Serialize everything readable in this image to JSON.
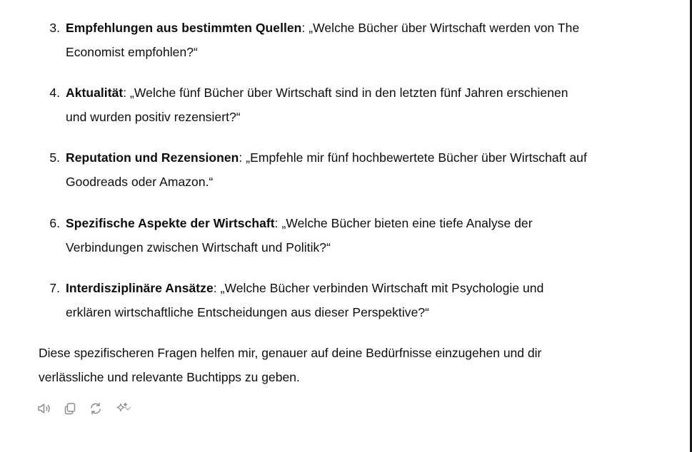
{
  "items": [
    {
      "number": "3.",
      "title": "Empfehlungen aus bestimmten Quellen",
      "line1": ": „Welche Bücher über Wirtschaft werden von The",
      "line2": "Economist empfohlen?“"
    },
    {
      "number": "4.",
      "title": "Aktualität",
      "line1": ": „Welche fünf Bücher über Wirtschaft sind in den letzten fünf Jahren erschienen",
      "line2": "und wurden positiv rezensiert?“"
    },
    {
      "number": "5.",
      "title": "Reputation und Rezensionen",
      "line1": ": „Empfehle mir fünf hochbewertete Bücher über Wirtschaft auf",
      "line2": "Goodreads oder Amazon.“"
    },
    {
      "number": "6.",
      "title": "Spezifische Aspekte der Wirtschaft",
      "line1": ": „Welche Bücher bieten eine tiefe Analyse der",
      "line2": "Verbindungen zwischen Wirtschaft und Politik?“"
    },
    {
      "number": "7.",
      "title": "Interdisziplinäre Ansätze",
      "line1": ": „Welche Bücher verbinden Wirtschaft mit Psychologie und",
      "line2": "erklären wirtschaftliche Entscheidungen aus dieser Perspektive?“"
    }
  ],
  "closing": {
    "line1": "Diese spezifischeren Fragen helfen mir, genauer auf deine Bedürfnisse einzugehen und dir",
    "line2": "verlässliche und relevante Buchtipps zu geben."
  },
  "actions": {
    "icons": [
      "speaker-icon",
      "copy-icon",
      "regenerate-icon",
      "sparkle-icon",
      "chevron-down-icon"
    ],
    "icon_color": "#8e8e8e"
  }
}
